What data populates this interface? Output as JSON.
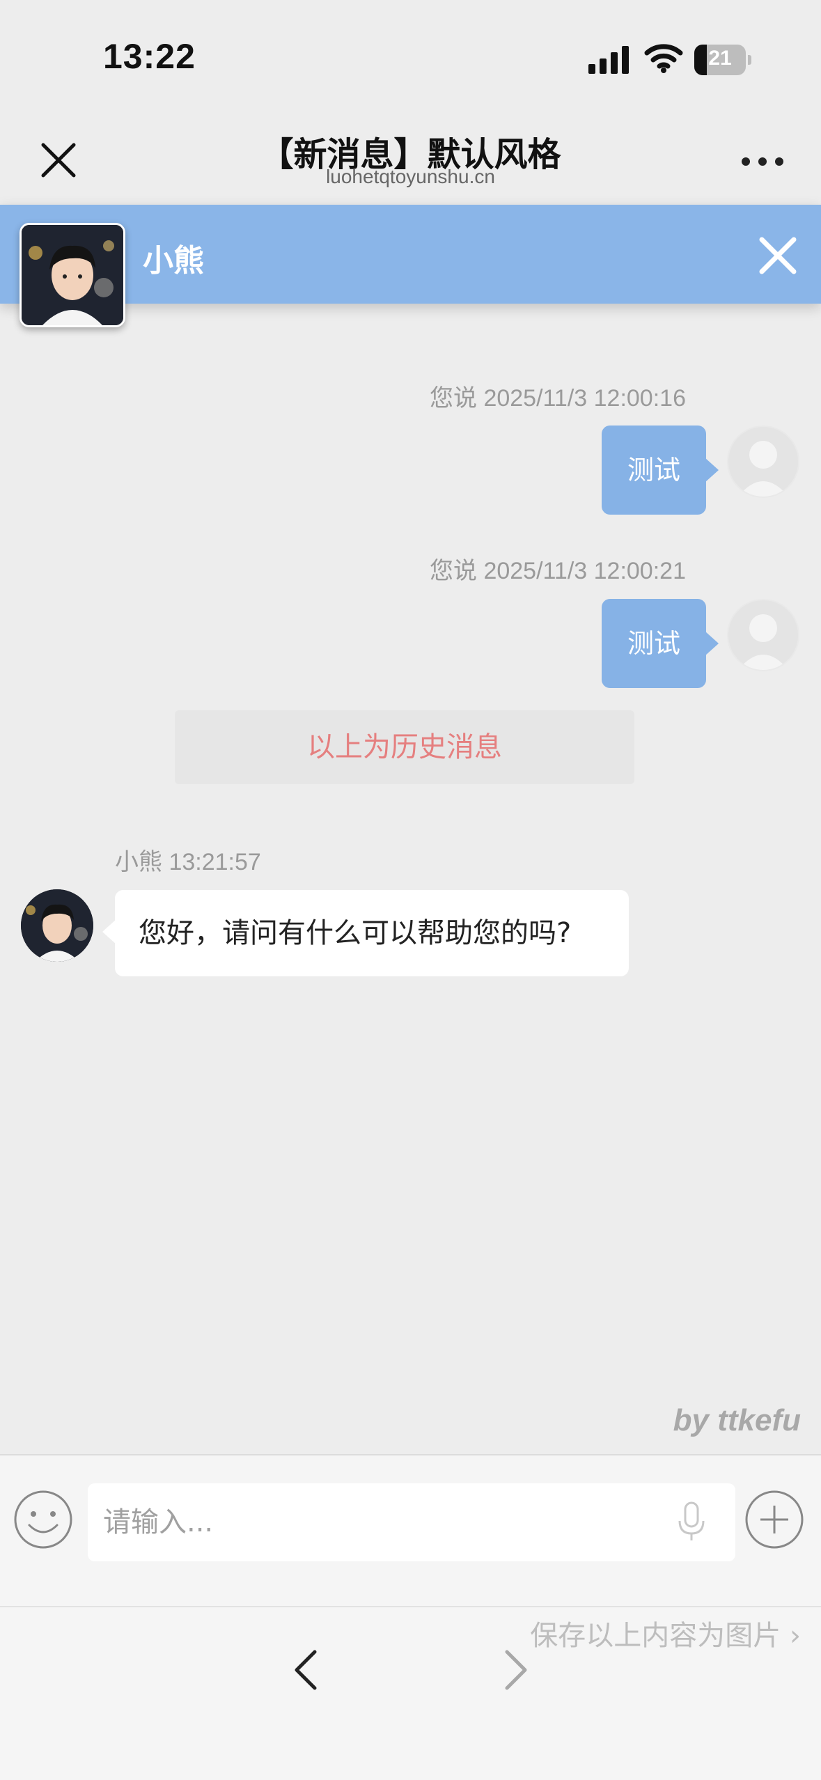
{
  "status_bar": {
    "time": "13:22",
    "battery": "21"
  },
  "header": {
    "title": "【新消息】默认风格",
    "subtitle": "luohetqtoyunshu.cn",
    "close_icon": "close-icon",
    "more_icon": "more-dots-icon"
  },
  "chat_bar": {
    "agent_name": "小熊",
    "close_icon": "close-icon",
    "color": "#8ab5e8"
  },
  "messages": [
    {
      "direction": "out",
      "meta": "您说 2025/11/3 12:00:16",
      "text": "测试"
    },
    {
      "direction": "out",
      "meta": "您说 2025/11/3 12:00:21",
      "text": "测试"
    },
    {
      "direction": "in",
      "meta": "小熊 13:21:57",
      "text": "您好，请问有什么可以帮助您的吗?"
    }
  ],
  "history_divider": "以上为历史消息",
  "watermark": "by ttkefu",
  "input": {
    "placeholder": "请输入...",
    "emoji_icon": "smiley-icon",
    "mic_icon": "microphone-icon",
    "plus_icon": "plus-circle-icon"
  },
  "footer": {
    "save_link": "保存以上内容为图片 ›",
    "back_icon": "chevron-left-icon",
    "forward_icon": "chevron-right-icon"
  },
  "colors": {
    "accent": "#8ab5e8",
    "outgoing_bubble": "#86b2e6",
    "history_text": "#e57f7f",
    "background": "#ededed"
  }
}
